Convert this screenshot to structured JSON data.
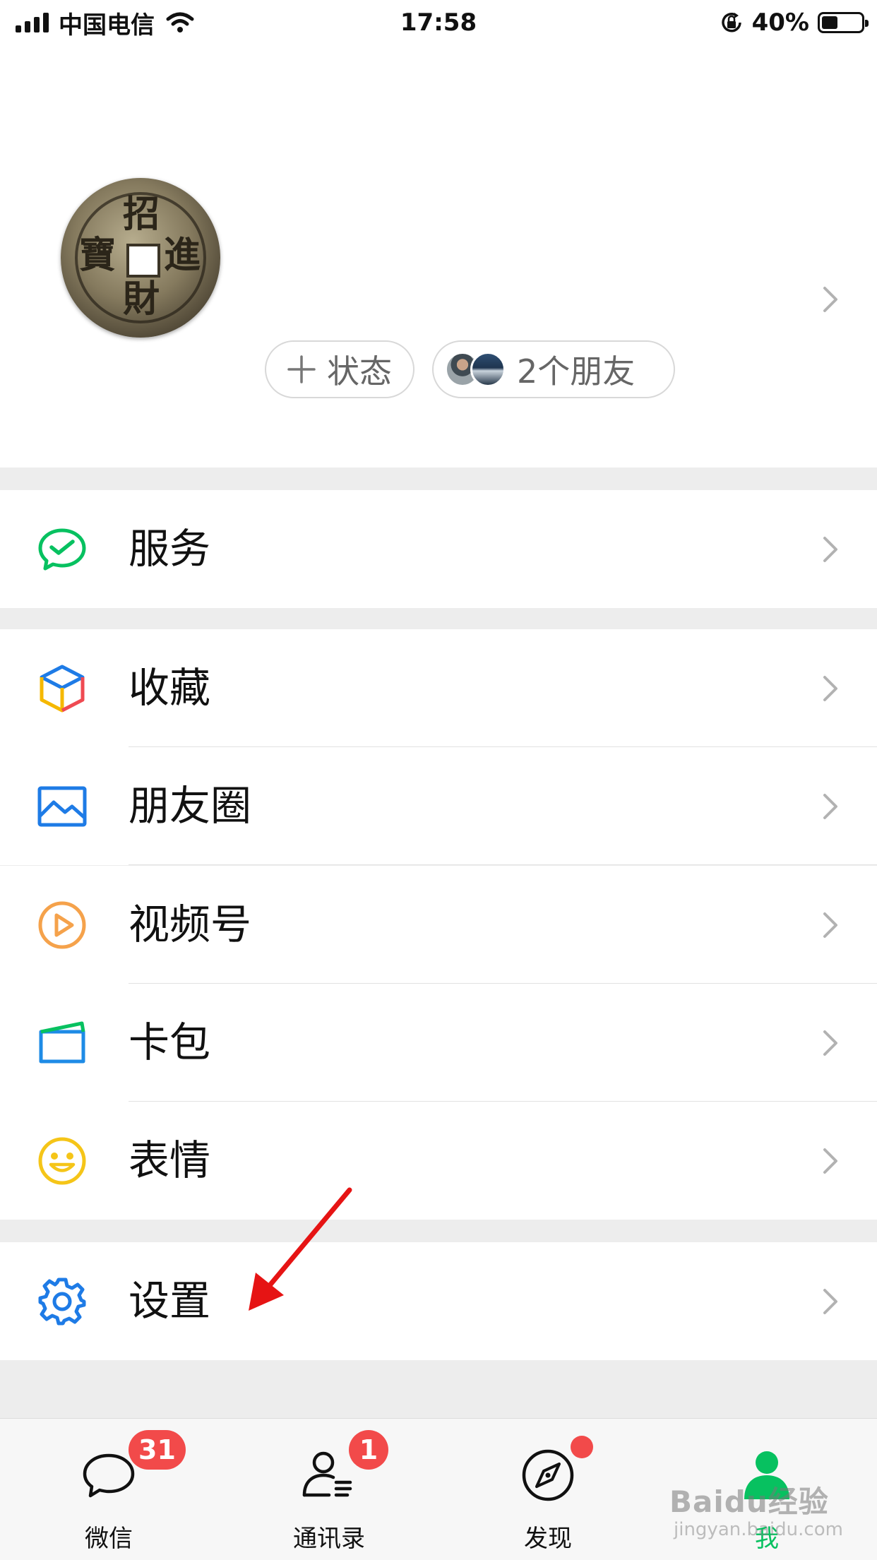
{
  "status_bar": {
    "carrier": "中国电信",
    "time": "17:58",
    "battery_percent": "40%",
    "battery_level": 0.4
  },
  "profile": {
    "avatar_text": [
      "招",
      "進",
      "財",
      "寶"
    ],
    "status_button": {
      "icon": "plus-icon",
      "label": "状态"
    },
    "friends_button": {
      "label": "2个朋友"
    }
  },
  "menu": {
    "service": {
      "label": "服务",
      "icon": "wechat-pay-check-icon",
      "color": "#07c160"
    },
    "favorites": {
      "label": "收藏",
      "icon": "cube-icon",
      "color": "#f5a623"
    },
    "moments": {
      "label": "朋友圈",
      "icon": "picture-icon",
      "color": "#1e7be6"
    },
    "channels": {
      "label": "视频号",
      "icon": "play-circle-icon",
      "color": "#f5a24b"
    },
    "cards": {
      "label": "卡包",
      "icon": "wallet-card-icon",
      "color": "#1e8be6"
    },
    "stickers": {
      "label": "表情",
      "icon": "smiley-icon",
      "color": "#f5c518"
    },
    "settings": {
      "label": "设置",
      "icon": "gear-icon",
      "color": "#1e7be6"
    }
  },
  "tabbar": {
    "chats": {
      "label": "微信",
      "badge": "31"
    },
    "contacts": {
      "label": "通讯录",
      "badge": "1"
    },
    "discover": {
      "label": "发现",
      "dot": true
    },
    "me": {
      "label": "我",
      "active": true
    }
  },
  "watermark": {
    "text": "Baidu经验",
    "url_text": "jingyan.baidu.com"
  },
  "colors": {
    "accent": "#07c160",
    "badge": "#f24a4a",
    "annotation_arrow": "#e61414"
  }
}
